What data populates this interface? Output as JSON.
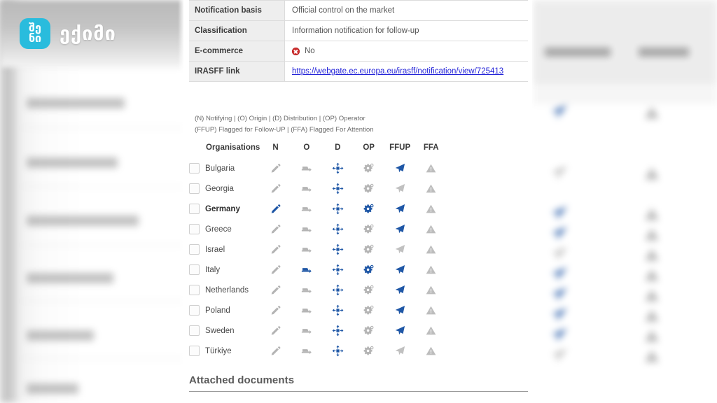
{
  "logo": {
    "mark_line1": "შე",
    "mark_line2": "ნი",
    "wordmark": "ექიმი",
    "brand_color": "#29bcdd"
  },
  "info_table": {
    "rows": [
      {
        "label": "Notification basis",
        "value": "Official control on the market",
        "type": "text"
      },
      {
        "label": "Classification",
        "value": "Information notification for follow-up",
        "type": "text"
      },
      {
        "label": "E-commerce",
        "value": "No",
        "type": "badge-no"
      },
      {
        "label": "IRASFF link",
        "value": "https://webgate.ec.europa.eu/irasff/notification/view/725413",
        "type": "link"
      }
    ]
  },
  "legend": {
    "line1": "(N) Notifying | (O) Origin | (D) Distribution | (OP) Operator",
    "line2": "(FFUP) Flagged for Follow-UP | (FFA) Flagged For Attention"
  },
  "org_table": {
    "headers": [
      "Organisations",
      "N",
      "O",
      "D",
      "OP",
      "FFUP",
      "FFA"
    ],
    "icon_names": [
      "pencil-icon",
      "truck-icon",
      "distribution-icon",
      "gear-icon",
      "paper-plane-icon",
      "warning-triangle-icon"
    ],
    "rows": [
      {
        "name": "Bulgaria",
        "bold": false,
        "checked": false,
        "N": "off",
        "O": "off",
        "D": "on",
        "OP": "off",
        "FFUP": "on",
        "FFA": "off"
      },
      {
        "name": "Georgia",
        "bold": false,
        "checked": false,
        "N": "off",
        "O": "off",
        "D": "on",
        "OP": "off",
        "FFUP": "off",
        "FFA": "off"
      },
      {
        "name": "Germany",
        "bold": true,
        "checked": false,
        "N": "on",
        "O": "off",
        "D": "on",
        "OP": "on",
        "FFUP": "on",
        "FFA": "off"
      },
      {
        "name": "Greece",
        "bold": false,
        "checked": false,
        "N": "off",
        "O": "off",
        "D": "on",
        "OP": "off",
        "FFUP": "on",
        "FFA": "off"
      },
      {
        "name": "Israel",
        "bold": false,
        "checked": false,
        "N": "off",
        "O": "off",
        "D": "on",
        "OP": "off",
        "FFUP": "off",
        "FFA": "off"
      },
      {
        "name": "Italy",
        "bold": false,
        "checked": false,
        "N": "off",
        "O": "on",
        "D": "on",
        "OP": "on",
        "FFUP": "on",
        "FFA": "off"
      },
      {
        "name": "Netherlands",
        "bold": false,
        "checked": false,
        "N": "off",
        "O": "off",
        "D": "on",
        "OP": "off",
        "FFUP": "on",
        "FFA": "off"
      },
      {
        "name": "Poland",
        "bold": false,
        "checked": false,
        "N": "off",
        "O": "off",
        "D": "on",
        "OP": "off",
        "FFUP": "on",
        "FFA": "off"
      },
      {
        "name": "Sweden",
        "bold": false,
        "checked": false,
        "N": "off",
        "O": "off",
        "D": "on",
        "OP": "off",
        "FFUP": "on",
        "FFA": "off"
      },
      {
        "name": "Türkiye",
        "bold": false,
        "checked": false,
        "N": "off",
        "O": "off",
        "D": "on",
        "OP": "off",
        "FFUP": "off",
        "FFA": "off"
      }
    ]
  },
  "attached": {
    "heading": "Attached documents"
  },
  "colors": {
    "accent_blue": "#1f57a6",
    "link_blue": "#2323d8",
    "inactive_gray": "#bcbcbc",
    "danger_red": "#cf2f2f"
  }
}
